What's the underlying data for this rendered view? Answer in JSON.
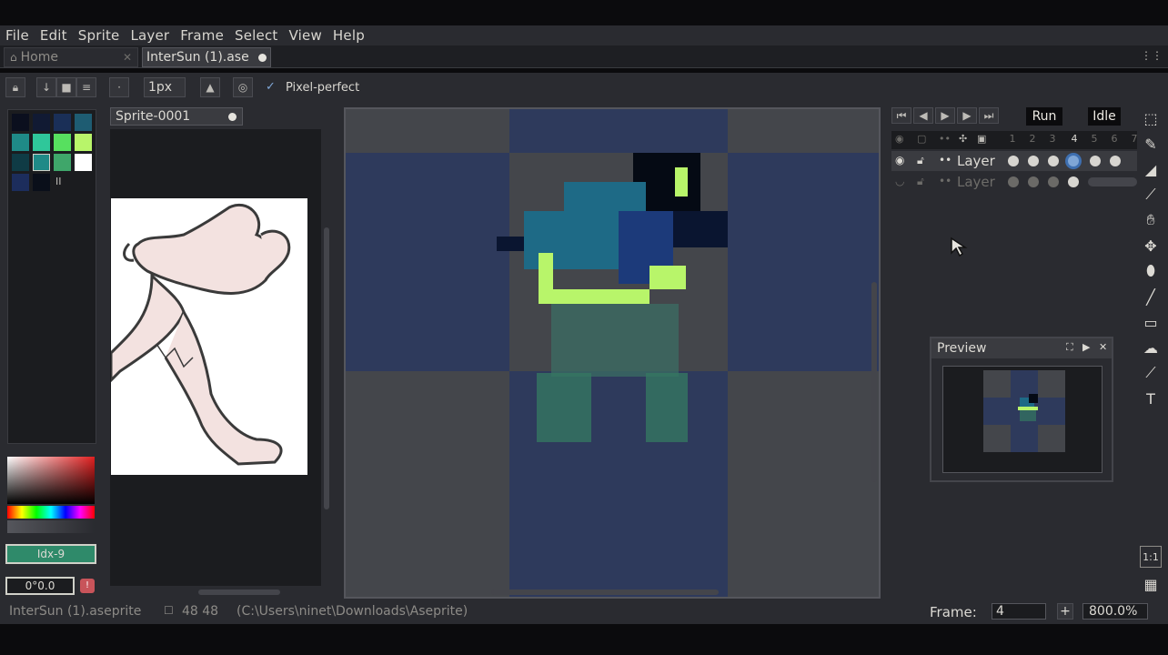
{
  "menu": [
    "File",
    "Edit",
    "Sprite",
    "Layer",
    "Frame",
    "Select",
    "View",
    "Help"
  ],
  "tabs": {
    "home": "Home",
    "active": "InterSun (1).ase"
  },
  "toolbar": {
    "brush_size": "1px",
    "pixel_perfect": "Pixel-perfect",
    "pixel_perfect_checked": true
  },
  "reference_tab": "Sprite-0001",
  "palette": {
    "colors": [
      "#0b0f1e",
      "#111a33",
      "#1a2f57",
      "#1e5c72",
      "#1f8a87",
      "#2fc79a",
      "#57e05f",
      "#b8f56a",
      "#0f3b45",
      "#d0d0c8",
      "#3fa66a",
      "#ffffff",
      "#1c2d5c",
      "#0a0f1a"
    ],
    "index_label": "Idx-9",
    "rgb_label": "0°0.0"
  },
  "timeline": {
    "tags": [
      "Run",
      "Idle"
    ],
    "frame_numbers": [
      "1",
      "2",
      "3",
      "4",
      "5",
      "6",
      "7"
    ],
    "active_frame": 4,
    "layers": [
      {
        "name": "Layer",
        "visible": true
      },
      {
        "name": "Layer",
        "visible": false
      }
    ]
  },
  "preview": {
    "title": "Preview"
  },
  "status": {
    "filename": "InterSun (1).aseprite",
    "size": "48 48",
    "path": "(C:\\Users\\ninet\\Downloads\\Aseprite)",
    "frame_label": "Frame:",
    "frame_value": "4",
    "zoom": "800.0%"
  },
  "icons": [
    "home-icon",
    "lock-icon",
    "arrow-down-icon",
    "stop-icon",
    "list-icon",
    "dot-icon",
    "stamp-icon",
    "spiral-icon",
    "check-icon",
    "first-frame-icon",
    "prev-frame-icon",
    "play-icon",
    "next-frame-icon",
    "last-frame-icon",
    "eye-icon",
    "marquee-icon",
    "pencil-icon",
    "eraser-icon",
    "eyedropper-icon",
    "hand-icon",
    "move-icon",
    "bucket-icon",
    "line-icon",
    "rectangle-icon",
    "blur-icon",
    "text-icon",
    "cursor-icon",
    "grid-icon"
  ]
}
